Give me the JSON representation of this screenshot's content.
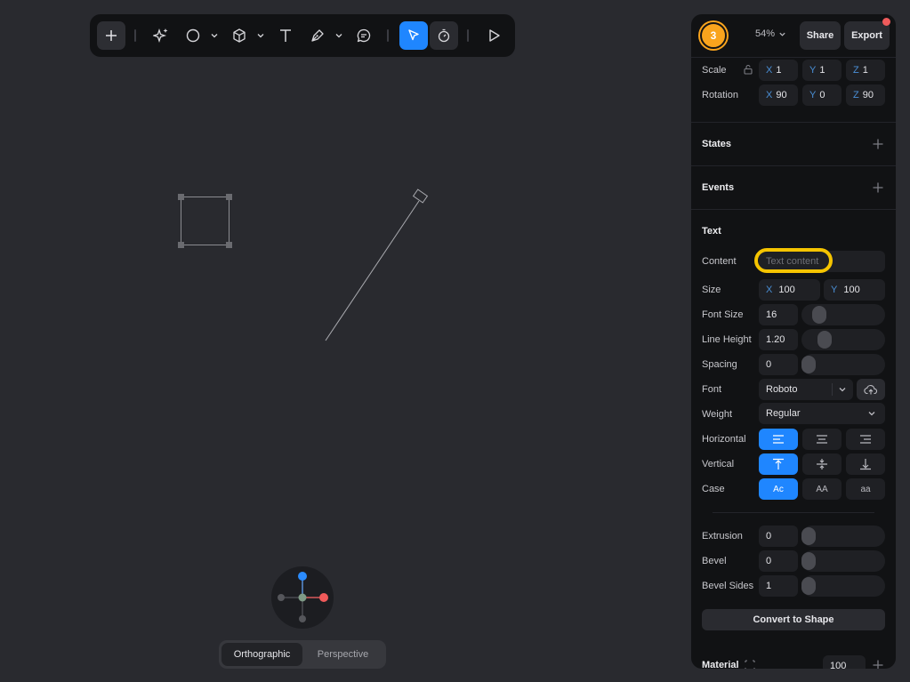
{
  "toolbar": {
    "tools": [
      "add",
      "ai",
      "shape",
      "3d",
      "text",
      "pen",
      "comment",
      "select",
      "animate",
      "play"
    ]
  },
  "view": {
    "orthographic_label": "Orthographic",
    "perspective_label": "Perspective",
    "active": "Orthographic"
  },
  "header": {
    "avatar_label": "3",
    "zoom_label": "54%",
    "share_label": "Share",
    "export_label": "Export"
  },
  "transform": {
    "scale_label": "Scale",
    "scale": {
      "x": "1",
      "y": "1",
      "z": "1"
    },
    "rotation_label": "Rotation",
    "rotation": {
      "x": "90",
      "y": "0",
      "z": "90"
    }
  },
  "states_label": "States",
  "events_label": "Events",
  "text_section": {
    "title": "Text",
    "content_label": "Content",
    "content_placeholder": "Text content",
    "size_label": "Size",
    "size": {
      "x": "100",
      "y": "100"
    },
    "font_size_label": "Font Size",
    "font_size": "16",
    "line_height_label": "Line Height",
    "line_height": "1.20",
    "spacing_label": "Spacing",
    "spacing": "0",
    "font_label": "Font",
    "font": "Roboto",
    "weight_label": "Weight",
    "weight": "Regular",
    "horizontal_label": "Horizontal",
    "vertical_label": "Vertical",
    "case_label": "Case",
    "case_options": [
      "Ac",
      "AA",
      "aa"
    ]
  },
  "geometry": {
    "extrusion_label": "Extrusion",
    "extrusion": "0",
    "bevel_label": "Bevel",
    "bevel": "0",
    "bevel_sides_label": "Bevel Sides",
    "bevel_sides": "1"
  },
  "convert_label": "Convert to Shape",
  "material": {
    "label": "Material",
    "value": "100"
  },
  "colors": {
    "accent": "#1f86ff",
    "avatar": "#f9a41d",
    "notification": "#ef5b5b",
    "highlight": "#f5c400"
  }
}
